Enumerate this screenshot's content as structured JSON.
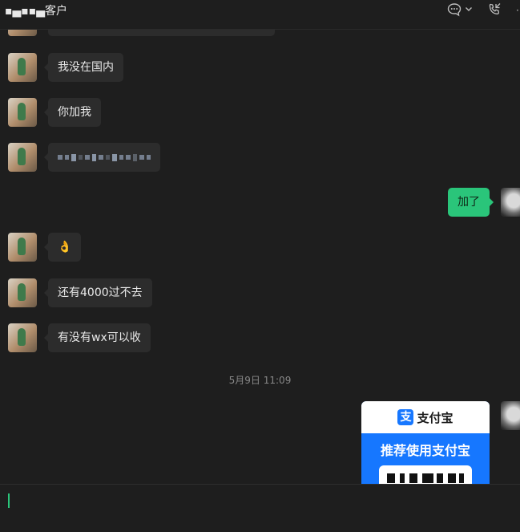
{
  "header": {
    "title": "▪▄▪▪▄客户",
    "icons": [
      "chat-bubble-icon",
      "chevron-down-icon",
      "phone-icon",
      "more-icon"
    ]
  },
  "messages": [
    {
      "side": "left",
      "text": "我没在国内"
    },
    {
      "side": "left",
      "text": "你加我"
    },
    {
      "side": "left",
      "text": ""
    },
    {
      "side": "right",
      "text": "加了"
    },
    {
      "side": "left",
      "text": "👌"
    },
    {
      "side": "left",
      "text": "还有4000过不去"
    },
    {
      "side": "left",
      "text": "有没有wx可以收"
    }
  ],
  "timestamp": "5月9日 11:09",
  "alipay_card": {
    "logo_glyph": "支",
    "brand": "支付宝",
    "slogan": "推荐使用支付宝"
  },
  "colors": {
    "background": "#1e1e1e",
    "bubble_other": "#2c2c2c",
    "bubble_me": "#2ac57a",
    "alipay": "#1677ff"
  }
}
